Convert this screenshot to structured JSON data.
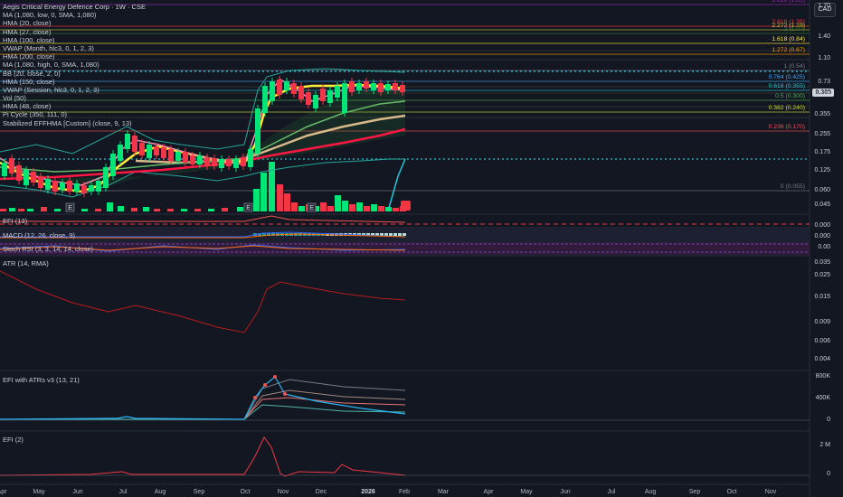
{
  "title": "Aegis Critical Energy Defence Corp · 1W · CSE",
  "currency_button": "CAD",
  "current_price": "0.385",
  "main_legend": [
    "MA (1,080, low, 0, SMA, 1,080)",
    "HMA (20, close)",
    "HMA (27, close)",
    "HMA (100, close)",
    "VWAP (Month, hlc3, 0, 1, 2, 3)",
    "HMA (200, close)",
    "MA (1,080, high, 0, SMA, 1,080)",
    "BB (20, close, 2, 0)",
    "HMA (150, close)",
    "VWAP (Session, hlc3, 0, 1, 2, 3)",
    "Vol (50)",
    "HMA (48, close)",
    "Pi Cycle (350, 111, 0)",
    "Stabilized EFFHMA [Custom] (close, 9, 13)"
  ],
  "price_axis": [
    "1.70",
    "1.40",
    "1.10",
    "0.73",
    "0.475",
    "0.355",
    "0.255",
    "0.175",
    "0.125",
    "0.060",
    "0.045"
  ],
  "fib_levels": [
    {
      "label": "3.618 (1.81)",
      "color": "#9c27b0"
    },
    {
      "label": "2.618 (1.35)",
      "color": "#f23645"
    },
    {
      "label": "2.272 (1.19)",
      "color": "#c0ca33"
    },
    {
      "label": "2 (1.07)",
      "color": "#2e7d32"
    },
    {
      "label": "1.618 (0.84)",
      "color": "#ffeb3b"
    },
    {
      "label": "1.272 (0.67)",
      "color": "#ff9800"
    },
    {
      "label": "1 (0.54)",
      "color": "#787b86"
    },
    {
      "label": "0.764 (0.425)",
      "color": "#42a5f5"
    },
    {
      "label": "0.618 (0.355)",
      "color": "#26c6da"
    },
    {
      "label": "0.5 (0.300)",
      "color": "#4caf50"
    },
    {
      "label": "0.382 (0.240)",
      "color": "#cddc39"
    },
    {
      "label": "0.236 (0.170)",
      "color": "#ef5350"
    },
    {
      "label": "0 (0.055)",
      "color": "#787b86"
    }
  ],
  "panes": {
    "efi13": {
      "title": "EFI (13)"
    },
    "macd": {
      "title": "MACD (12, 26, close, 9)",
      "axis": [
        "0.000",
        "0.000"
      ]
    },
    "stoch": {
      "title": "Stoch RSI (3, 3, 14, 14, close)",
      "axis": [
        "0.00"
      ]
    },
    "atr": {
      "title": "ATR (14, RMA)",
      "axis": [
        "0.035",
        "0.025",
        "0.015",
        "0.009",
        "0.006",
        "0.004"
      ]
    },
    "efiatr": {
      "title": "EFI with ATRs v3 (13, 21)",
      "axis": [
        "800K",
        "400K",
        "0"
      ]
    },
    "efi2": {
      "title": "EFI (2)",
      "axis": [
        "2 M",
        "0"
      ]
    }
  },
  "earnings_marker": "E",
  "x_axis": [
    {
      "label": "Apr",
      "bold": false
    },
    {
      "label": "May",
      "bold": false
    },
    {
      "label": "Jun",
      "bold": false
    },
    {
      "label": "Jul",
      "bold": false
    },
    {
      "label": "Aug",
      "bold": false
    },
    {
      "label": "Sep",
      "bold": false
    },
    {
      "label": "Oct",
      "bold": false
    },
    {
      "label": "Nov",
      "bold": false
    },
    {
      "label": "Dec",
      "bold": false
    },
    {
      "label": "2026",
      "bold": true
    },
    {
      "label": "Feb",
      "bold": false
    },
    {
      "label": "Mar",
      "bold": false
    },
    {
      "label": "Apr",
      "bold": false
    },
    {
      "label": "May",
      "bold": false
    },
    {
      "label": "Jun",
      "bold": false
    },
    {
      "label": "Jul",
      "bold": false
    },
    {
      "label": "Aug",
      "bold": false
    },
    {
      "label": "Sep",
      "bold": false
    },
    {
      "label": "Oct",
      "bold": false
    },
    {
      "label": "Nov",
      "bold": false
    }
  ],
  "colors": {
    "up": "#00e676",
    "down": "#f23645",
    "bg": "#131722",
    "hma_yellow": "#ffeb3b",
    "ma_red": "#ff1744",
    "panel_div": "#2a2e39"
  }
}
